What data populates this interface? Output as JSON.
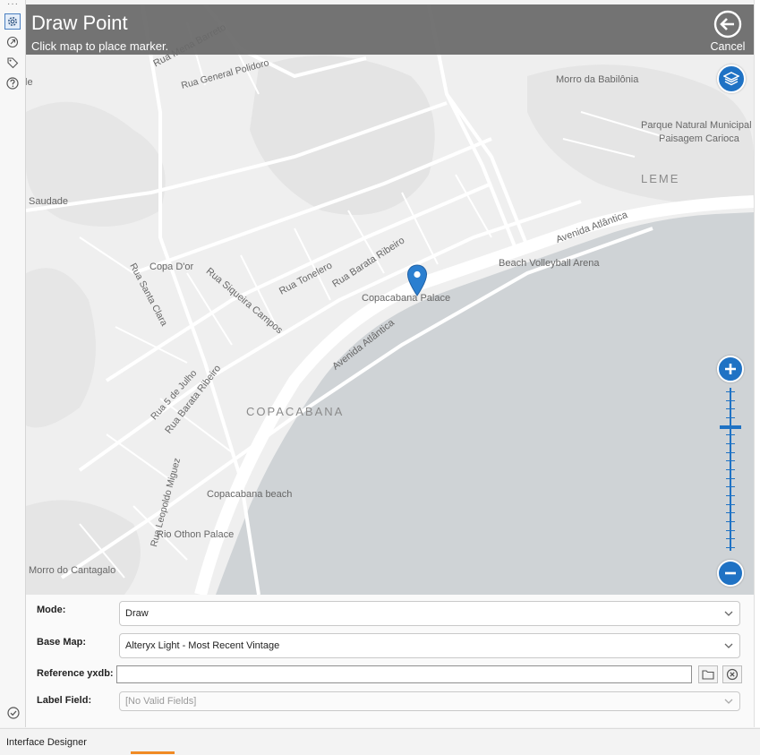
{
  "window": {
    "status_text": "Interface Designer"
  },
  "header": {
    "title": "Draw Point",
    "subtitle": "Click map to place marker.",
    "cancel_label": "Cancel"
  },
  "map": {
    "labels": {
      "rua_mena_barreto": "Rua Mena Barreto",
      "rua_general_polidoro": "Rua General Polidoro",
      "morro_babilonia": "Morro da Babilônia",
      "parque_natural_1": "Parque Natural Municipal",
      "parque_natural_2": "Paisagem Carioca",
      "leme": "LEME",
      "saudade": "Saudade",
      "avenida_atlantica_1": "Avenida Atlântica",
      "beach_volleyball": "Beach Volleyball Arena",
      "rua_barata_ribeiro_1": "Rua Barata Ribeiro",
      "rua_tonelero": "Rua Tonelero",
      "copa_dor": "Copa D'or",
      "rua_siqueira_campos": "Rua Siqueira Campos",
      "rua_santa_clara": "Rua Santa Clara",
      "copacabana_palace": "Copacabana Palace",
      "avenida_atlantica_2": "Avenida Atlântica",
      "rua_5_julho": "Rua 5 de Julho",
      "rua_barata_ribeiro_2": "Rua Barata Ribeiro",
      "copacabana": "COPACABANA",
      "rua_leopoldo_miguez": "Rua Leopoldo Miguez",
      "copacabana_beach": "Copacabana beach",
      "rio_othon": "Rio Othon Palace",
      "morro_cantagalo": "Morro do Cantagalo",
      "le_fragment": "le"
    },
    "zoom_level_fraction": 0.78
  },
  "form": {
    "mode_label": "Mode:",
    "mode_value": "Draw",
    "basemap_label": "Base Map:",
    "basemap_value": "Alteryx Light - Most Recent Vintage",
    "reference_label": "Reference yxdb:",
    "reference_value": "",
    "label_field_label": "Label Field:",
    "label_field_value": "[No Valid Fields]"
  },
  "colors": {
    "accent": "#1f72c4",
    "water": "#cfd3d6",
    "land": "#efefef",
    "header": "#696969"
  },
  "icons": {
    "rail": [
      "gear-icon",
      "export-icon",
      "tag-icon",
      "help-icon"
    ],
    "bottom": "check-circle-icon",
    "header": "back-arrow-circle-icon",
    "map": [
      "layers-icon",
      "zoom-in-icon",
      "zoom-out-icon",
      "map-marker-icon"
    ],
    "form": [
      "chevron-down-icon",
      "folder-icon",
      "clear-circle-icon"
    ]
  }
}
